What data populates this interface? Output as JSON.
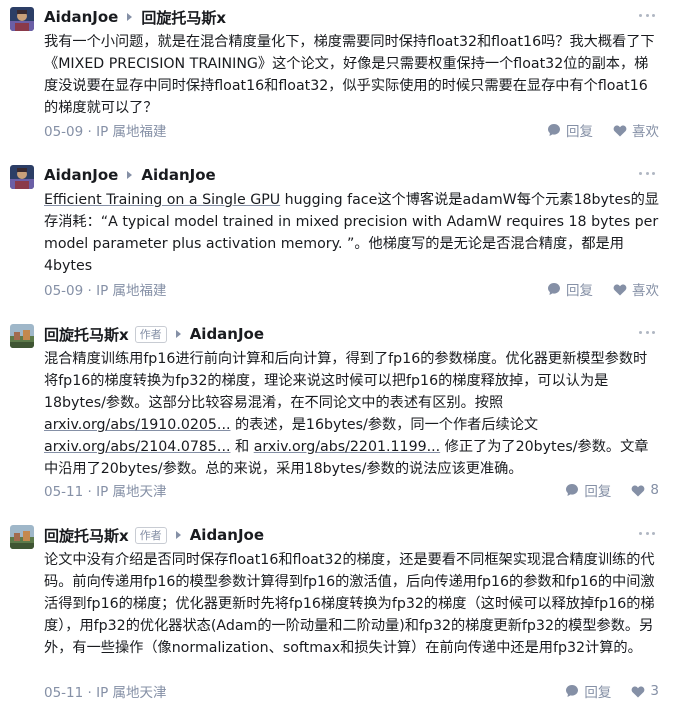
{
  "comments": [
    {
      "author": "AidanJoe",
      "reply_to": "回旋托马斯x",
      "content": "我有一个小问题，就是在混合精度量化下，梯度需要同时保持float32和float16吗？我大概看了下《MIXED PRECISION TRAINING》这个论文，好像是只需要权重保持一个float32位的副本，梯度没说要在显存中同时保持float16和float32，似乎实际使用的时候只需要在显存中有个float16的梯度就可以了？",
      "date": "05-09",
      "location": "IP 属地福建",
      "reply_label": "回复",
      "like_label": "喜欢"
    },
    {
      "author": "AidanJoe",
      "reply_to": "AidanJoe",
      "link_text": "Efficient Training on a Single GPU",
      "content": " hugging face这个博客说是adamW每个元素18bytes的显存消耗：“A typical model trained in mixed precision with AdamW requires 18 bytes per model parameter plus activation memory. ”。他梯度写的是无论是否混合精度，都是用4bytes",
      "date": "05-09",
      "location": "IP 属地福建",
      "reply_label": "回复",
      "like_label": "喜欢"
    },
    {
      "author": "回旋托马斯x",
      "author_tag": "作者",
      "reply_to": "AidanJoe",
      "content_a": "混合精度训练用fp16进行前向计算和后向计算，得到了fp16的参数梯度。优化器更新模型参数时将fp16的梯度转换为fp32的梯度，理论来说这时候可以把fp16的梯度释放掉，可以认为是18bytes/参数。这部分比较容易混淆，在不同论文中的表述有区别。按照",
      "link1": "arxiv.org/abs/1910.0205...",
      "content_b": " 的表述，是16bytes/参数，同一个作者后续论文",
      "link2": "arxiv.org/abs/2104.0785...",
      "content_c": " 和 ",
      "link3": "arxiv.org/abs/2201.1199...",
      "content_d": " 修正了为了20bytes/参数。文章中沿用了20bytes/参数。总的来说，采用18bytes/参数的说法应该更准确。",
      "date": "05-11",
      "location": "IP 属地天津",
      "reply_label": "回复",
      "like_count": "8"
    },
    {
      "author": "回旋托马斯x",
      "author_tag": "作者",
      "reply_to": "AidanJoe",
      "content": "论文中没有介绍是否同时保存float16和float32的梯度，还是要看不同框架实现混合精度训练的代码。前向传递用fp16的模型参数计算得到fp16的激活值，后向传递用fp16的参数和fp16的中间激活得到fp16的梯度；优化器更新时先将fp16梯度转换为fp32的梯度（这时候可以释放掉fp16的梯度），用fp32的优化器状态(Adam的一阶动量和二阶动量)和fp32的梯度更新fp32的模型参数。另外，有一些操作（像normalization、softmax和损失计算）在前向传递中还是用fp32计算的。",
      "date": "05-11",
      "location": "IP 属地天津",
      "reply_label": "回复",
      "like_count": "3"
    }
  ],
  "colors": {
    "meta": "#8590a6",
    "text": "#191b1f"
  },
  "icons": {
    "reply": "speech-bubble-icon",
    "like": "heart-icon",
    "more": "more-dots-icon"
  }
}
